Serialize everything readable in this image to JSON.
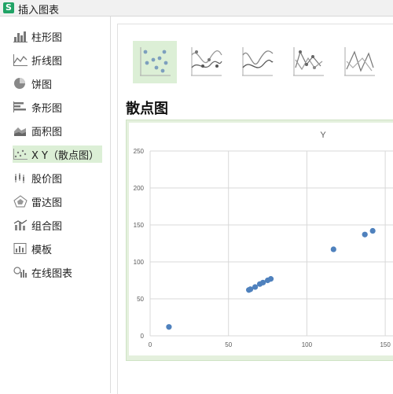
{
  "window": {
    "title": "插入图表"
  },
  "sidebar": {
    "items": [
      {
        "label": "柱形图"
      },
      {
        "label": "折线图"
      },
      {
        "label": "饼图"
      },
      {
        "label": "条形图"
      },
      {
        "label": "面积图"
      },
      {
        "label": "X Y（散点图）",
        "selected": true
      },
      {
        "label": "股价图"
      },
      {
        "label": "雷达图"
      },
      {
        "label": "组合图"
      },
      {
        "label": "模板"
      },
      {
        "label": "在线图表"
      }
    ]
  },
  "section": {
    "title": "散点图"
  },
  "colors": {
    "accent": "#dcefd6",
    "point": "#4f81bd"
  },
  "chart_data": {
    "type": "scatter",
    "title": "Y",
    "x_ticks": [
      "0",
      "50",
      "100",
      "150"
    ],
    "y_ticks": [
      "0",
      "50",
      "100",
      "150",
      "200",
      "250"
    ],
    "xlim": [
      0,
      170
    ],
    "ylim": [
      0,
      250
    ],
    "grid": true,
    "points": [
      [
        12,
        12
      ],
      [
        63,
        62
      ],
      [
        64,
        63
      ],
      [
        67,
        66
      ],
      [
        70,
        70
      ],
      [
        72,
        72
      ],
      [
        75,
        75
      ],
      [
        77,
        77
      ],
      [
        117,
        117
      ],
      [
        137,
        137
      ],
      [
        142,
        142
      ]
    ]
  }
}
